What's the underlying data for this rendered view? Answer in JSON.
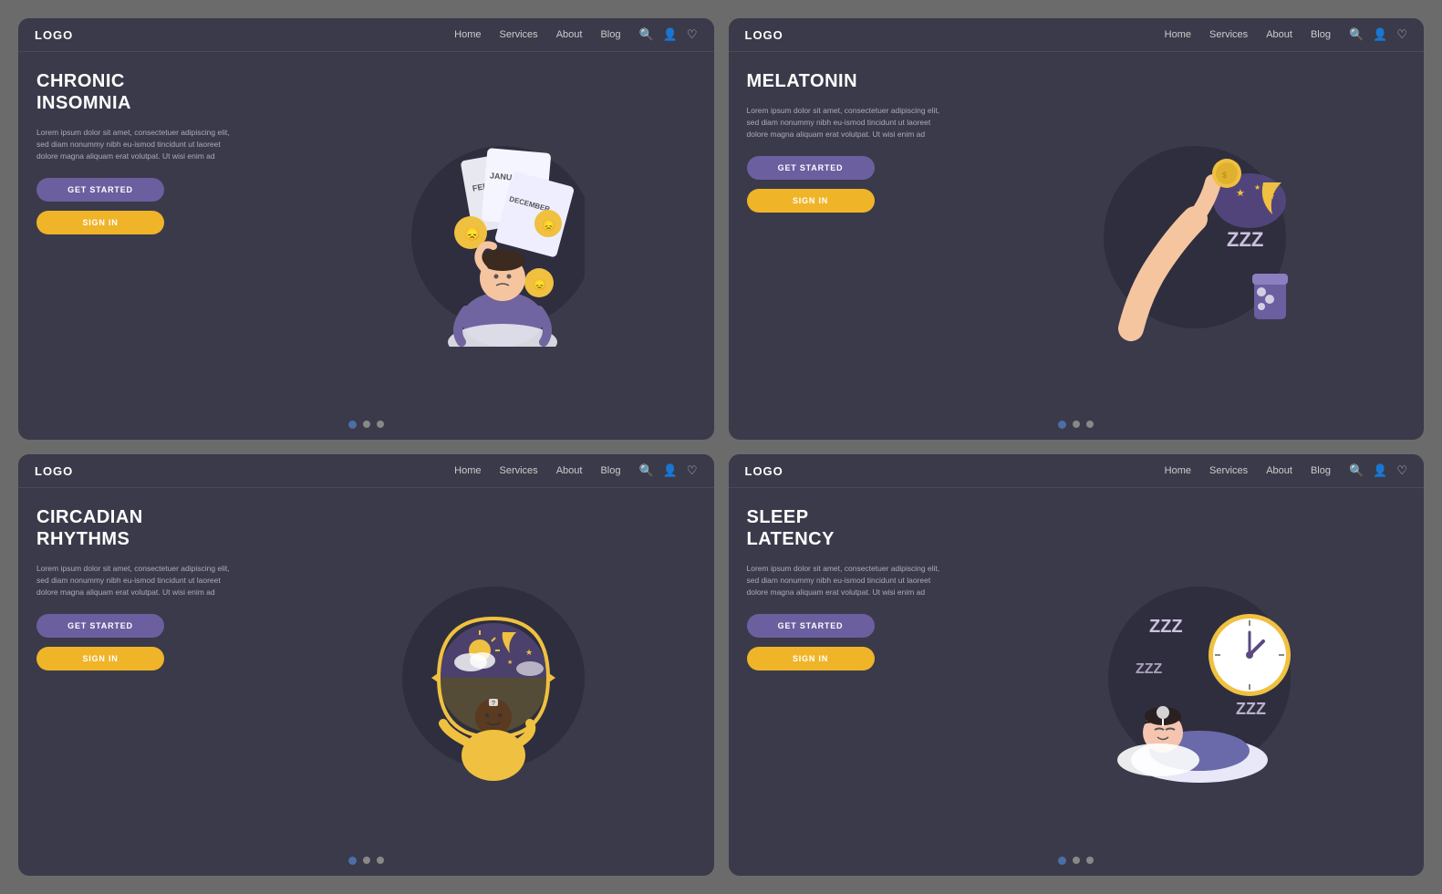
{
  "cards": [
    {
      "id": "chronic-insomnia",
      "logo": "LOGO",
      "nav": {
        "home": "Home",
        "services": "Services",
        "about": "About",
        "blog": "Blog"
      },
      "title": "CHRONIC\nINSOMNIA",
      "body": "Lorem ipsum dolor sit amet, consectetuer adipiscing elit, sed diam nonummy nibh eu-ismod tincidunt ut laoreet dolore magna aliquam erat volutpat. Ut wisi enim ad",
      "btn_started": "GET STARTED",
      "btn_signin": "SIGN IN",
      "dots": [
        true,
        false,
        false
      ],
      "illustration": "insomnia"
    },
    {
      "id": "melatonin",
      "logo": "LOGO",
      "nav": {
        "home": "Home",
        "services": "Services",
        "about": "About",
        "blog": "Blog"
      },
      "title": "MELATONIN",
      "body": "Lorem ipsum dolor sit amet, consectetuer adipiscing elit, sed diam nonummy nibh eu-ismod tincidunt ut laoreet dolore magna aliquam erat volutpat. Ut wisi enim ad",
      "btn_started": "GET STARTED",
      "btn_signin": "SIGN IN",
      "dots": [
        true,
        false,
        false
      ],
      "illustration": "melatonin"
    },
    {
      "id": "circadian-rhythms",
      "logo": "LOGO",
      "nav": {
        "home": "Home",
        "services": "Services",
        "about": "About",
        "blog": "Blog"
      },
      "title": "CIRCADIAN\nRHYTHMS",
      "body": "Lorem ipsum dolor sit amet, consectetuer adipiscing elit, sed diam nonummy nibh eu-ismod tincidunt ut laoreet dolore magna aliquam erat volutpat. Ut wisi enim ad",
      "btn_started": "GET STARTED",
      "btn_signin": "SIGN IN",
      "dots": [
        true,
        false,
        false
      ],
      "illustration": "circadian"
    },
    {
      "id": "sleep-latency",
      "logo": "LOGO",
      "nav": {
        "home": "Home",
        "services": "Services",
        "about": "About",
        "blog": "Blog"
      },
      "title": "SLEEP\nLATENCY",
      "body": "Lorem ipsum dolor sit amet, consectetuer adipiscing elit, sed diam nonummy nibh eu-ismod tincidunt ut laoreet dolore magna aliquam erat volutpat. Ut wisi enim ad",
      "btn_started": "GET STARTED",
      "btn_signin": "SIGN IN",
      "dots": [
        true,
        false,
        false
      ],
      "illustration": "sleep-latency"
    }
  ]
}
